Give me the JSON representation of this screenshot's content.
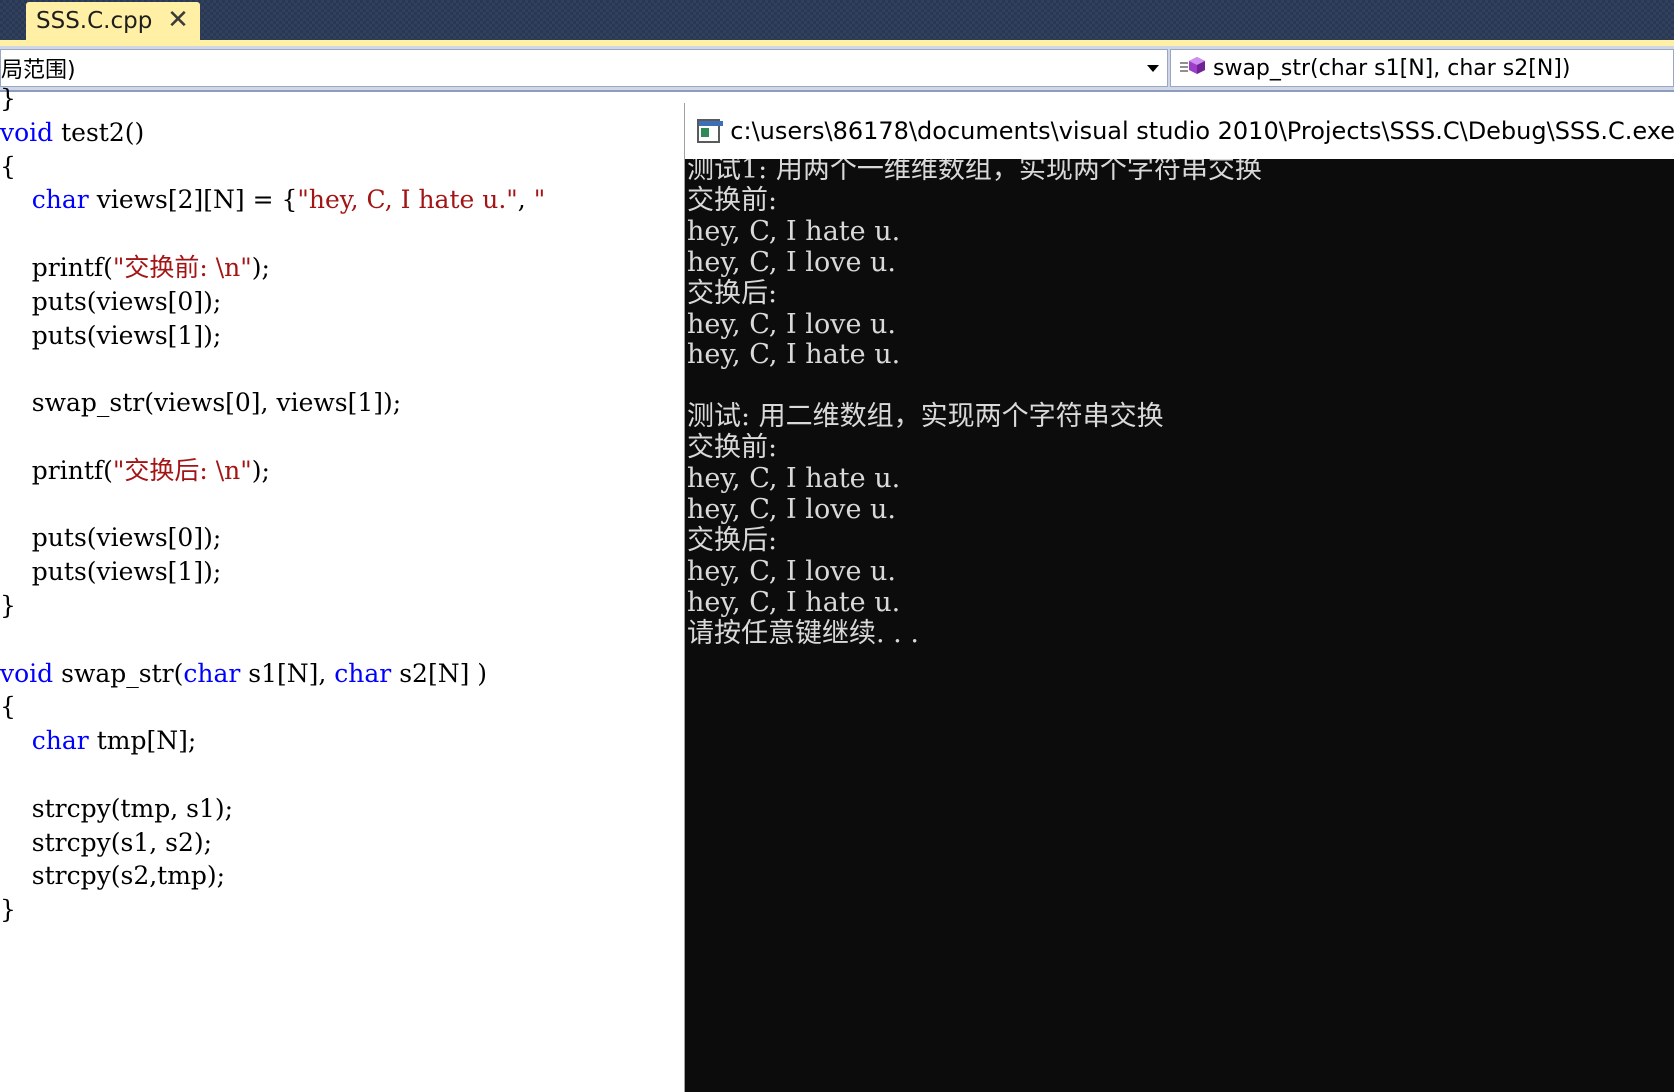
{
  "tab": {
    "label": "SSS.C.cpp",
    "close_glyph": "✕"
  },
  "navbar": {
    "scope_value": "局范围)",
    "member_value": "swap_str(char s1[N], char s2[N])",
    "member_icon": "method-icon"
  },
  "editor": {
    "lines": [
      [
        {
          "t": "}",
          "c": "p"
        }
      ],
      [
        {
          "t": "void",
          "c": "kw"
        },
        {
          "t": " test2()",
          "c": "p"
        }
      ],
      [
        {
          "t": "{",
          "c": "p"
        }
      ],
      [
        {
          "t": "    ",
          "c": "p"
        },
        {
          "t": "char",
          "c": "kw"
        },
        {
          "t": " views[2][N] = {",
          "c": "p"
        },
        {
          "t": "\"hey, C, I hate u.\"",
          "c": "str"
        },
        {
          "t": ", ",
          "c": "p"
        },
        {
          "t": "\"",
          "c": "str"
        }
      ],
      [
        {
          "t": "",
          "c": "p"
        }
      ],
      [
        {
          "t": "    printf(",
          "c": "p"
        },
        {
          "t": "\"交换前: \\n\"",
          "c": "str"
        },
        {
          "t": ");",
          "c": "p"
        }
      ],
      [
        {
          "t": "    puts(views[0]);",
          "c": "p"
        }
      ],
      [
        {
          "t": "    puts(views[1]);",
          "c": "p"
        }
      ],
      [
        {
          "t": "",
          "c": "p"
        }
      ],
      [
        {
          "t": "    swap_str(views[0], views[1]);",
          "c": "p"
        }
      ],
      [
        {
          "t": "",
          "c": "p"
        }
      ],
      [
        {
          "t": "    printf(",
          "c": "p"
        },
        {
          "t": "\"交换后: \\n\"",
          "c": "str"
        },
        {
          "t": ");",
          "c": "p"
        }
      ],
      [
        {
          "t": "",
          "c": "p"
        }
      ],
      [
        {
          "t": "    puts(views[0]);",
          "c": "p"
        }
      ],
      [
        {
          "t": "    puts(views[1]);",
          "c": "p"
        }
      ],
      [
        {
          "t": "}",
          "c": "p"
        }
      ],
      [
        {
          "t": "",
          "c": "p"
        }
      ],
      [
        {
          "t": "void",
          "c": "kw"
        },
        {
          "t": " swap_str(",
          "c": "p"
        },
        {
          "t": "char",
          "c": "kw"
        },
        {
          "t": " s1[N], ",
          "c": "p"
        },
        {
          "t": "char",
          "c": "kw"
        },
        {
          "t": " s2[N] )",
          "c": "p"
        }
      ],
      [
        {
          "t": "{",
          "c": "p"
        }
      ],
      [
        {
          "t": "    ",
          "c": "p"
        },
        {
          "t": "char",
          "c": "kw"
        },
        {
          "t": " tmp[N];",
          "c": "p"
        }
      ],
      [
        {
          "t": "",
          "c": "p"
        }
      ],
      [
        {
          "t": "    strcpy(tmp, s1);",
          "c": "p"
        }
      ],
      [
        {
          "t": "    strcpy(s1, s2);",
          "c": "p"
        }
      ],
      [
        {
          "t": "    strcpy(s2,tmp);",
          "c": "p"
        }
      ],
      [
        {
          "t": "}",
          "c": "p"
        }
      ]
    ],
    "colors": {
      "keyword": "#0000ff",
      "string": "#a31515",
      "text": "#000000"
    }
  },
  "console": {
    "title": "c:\\users\\86178\\documents\\visual studio 2010\\Projects\\SSS.C\\Debug\\SSS.C.exe",
    "output": [
      "测试1: 用两个一维维数组，实现两个字符串交换",
      "交换前:",
      "hey, C, I hate u.",
      "hey, C, I love u.",
      "交换后:",
      "hey, C, I love u.",
      "hey, C, I hate u.",
      "",
      "测试: 用二维数组，实现两个字符串交换",
      "交换前:",
      "hey, C, I hate u.",
      "hey, C, I love u.",
      "交换后:",
      "hey, C, I love u.",
      "hey, C, I hate u.",
      "请按任意键继续. . ."
    ],
    "colors": {
      "background": "#0c0c0c",
      "text": "#d9d9d9"
    }
  }
}
